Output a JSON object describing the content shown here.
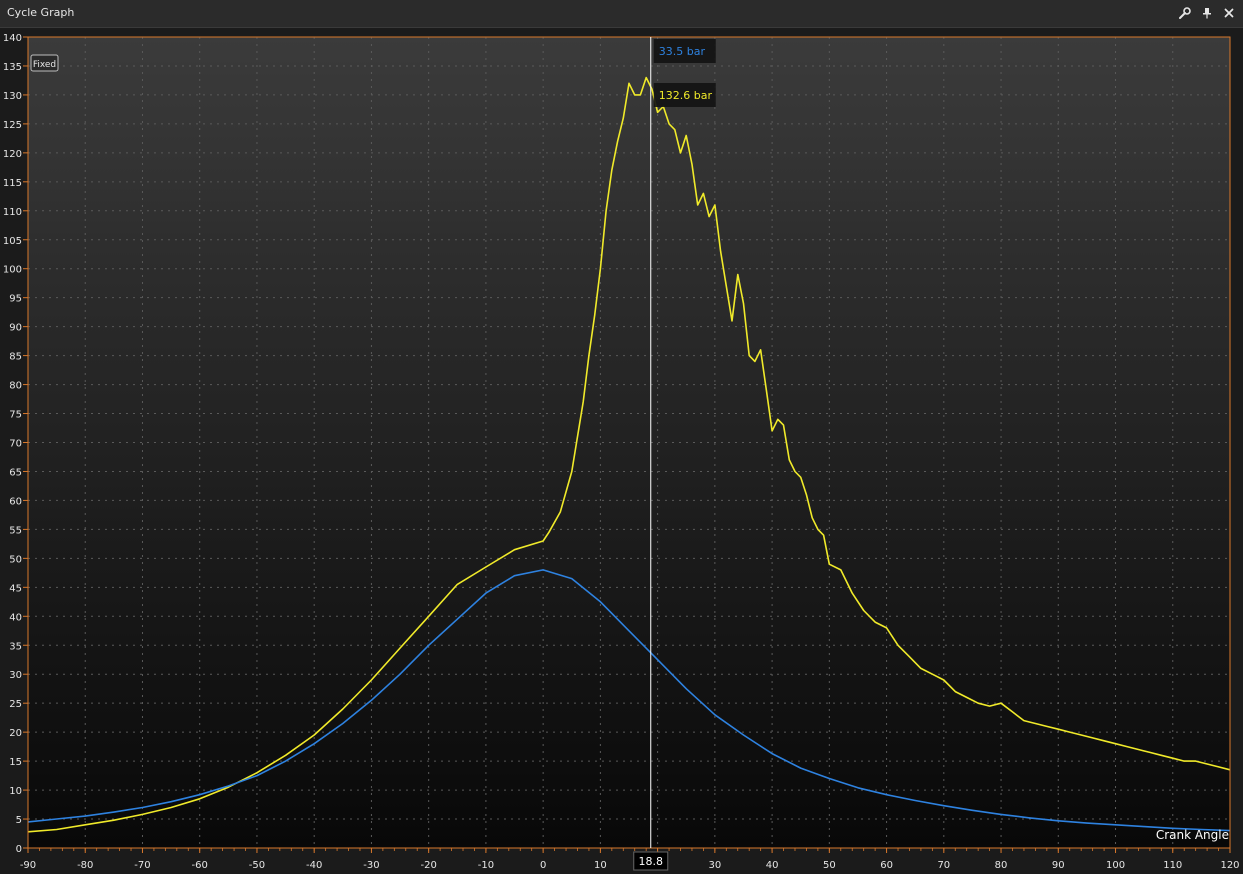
{
  "window": {
    "title": "Cycle Graph",
    "icons": [
      "wrench-icon",
      "pin-icon",
      "close-icon"
    ]
  },
  "colors": {
    "plot_bg_top": "#3b3b3b",
    "plot_bg_bottom": "#080808",
    "border": "#d9782b",
    "grid": "#5a5a5a",
    "series_yellow": "#f0ea2a",
    "series_blue": "#2e82e0",
    "cursor": "#ffffff"
  },
  "chart_data": {
    "type": "line",
    "title": "",
    "xlabel": "Crank Angle",
    "ylabel": "",
    "xlim": [
      -90,
      120
    ],
    "ylim": [
      0,
      140
    ],
    "x_ticks": [
      -90,
      -80,
      -70,
      -60,
      -50,
      -40,
      -30,
      -20,
      -10,
      0,
      10,
      20,
      30,
      40,
      50,
      60,
      70,
      80,
      90,
      100,
      110,
      120
    ],
    "y_ticks": [
      0,
      5,
      10,
      15,
      20,
      25,
      30,
      35,
      40,
      45,
      50,
      55,
      60,
      65,
      70,
      75,
      80,
      85,
      90,
      95,
      100,
      105,
      110,
      115,
      120,
      125,
      130,
      135,
      140
    ],
    "grid": true,
    "badge": "Fixed",
    "cursor": {
      "x": 18.8,
      "x_label": "18.8",
      "readouts": [
        {
          "label": "33.5 bar",
          "value": 33.5,
          "color": "#2e82e0"
        },
        {
          "label": "132.6 bar",
          "value": 132.6,
          "color": "#f0ea2a"
        }
      ]
    },
    "series": [
      {
        "color": "#f0ea2a",
        "x": [
          -90,
          -85,
          -80,
          -75,
          -70,
          -65,
          -60,
          -55,
          -50,
          -45,
          -40,
          -35,
          -30,
          -25,
          -20,
          -15,
          -10,
          -5,
          0,
          1,
          3,
          5,
          7,
          8,
          9,
          10,
          11,
          12,
          13,
          14,
          15,
          16,
          17,
          18,
          19,
          20,
          21,
          22,
          23,
          24,
          25,
          26,
          27,
          28,
          29,
          30,
          31,
          32,
          33,
          34,
          35,
          36,
          37,
          38,
          39,
          40,
          41,
          42,
          43,
          44,
          45,
          46,
          47,
          48,
          49,
          50,
          52,
          54,
          56,
          58,
          60,
          62,
          64,
          66,
          68,
          70,
          72,
          74,
          76,
          78,
          80,
          82,
          84,
          86,
          88,
          90,
          92,
          94,
          96,
          98,
          100,
          102,
          104,
          106,
          108,
          110,
          112,
          114,
          116,
          118,
          120
        ],
        "values": [
          2.8,
          3.2,
          4.0,
          4.8,
          5.8,
          7.0,
          8.5,
          10.5,
          13.0,
          16.0,
          19.5,
          24.0,
          29.0,
          34.5,
          40.0,
          45.5,
          48.5,
          51.5,
          53.0,
          54.5,
          58.0,
          65.0,
          77.0,
          85.0,
          92.0,
          100.0,
          110.0,
          117.0,
          122.0,
          126.0,
          132.0,
          130.0,
          130.0,
          133.0,
          131.0,
          127.0,
          128.0,
          125.0,
          124.0,
          120.0,
          123.0,
          118.0,
          111.0,
          113.0,
          109.0,
          111.0,
          103.0,
          97.0,
          91.0,
          99.0,
          94.0,
          85.0,
          84.0,
          86.0,
          79.0,
          72.0,
          74.0,
          73.0,
          67.0,
          65.0,
          64.0,
          61.0,
          57.0,
          55.0,
          54.0,
          49.0,
          48.0,
          44.0,
          41.0,
          39.0,
          38.0,
          35.0,
          33.0,
          31.0,
          30.0,
          29.0,
          27.0,
          26.0,
          25.0,
          24.5,
          25.0,
          23.5,
          22.0,
          21.5,
          21.0,
          20.5,
          20.0,
          19.5,
          19.0,
          18.5,
          18.0,
          17.5,
          17.0,
          16.5,
          16.0,
          15.5,
          15.0,
          15.0,
          14.5,
          14.0,
          13.5
        ]
      },
      {
        "color": "#2e82e0",
        "x": [
          -90,
          -85,
          -80,
          -75,
          -70,
          -65,
          -60,
          -55,
          -50,
          -45,
          -40,
          -35,
          -30,
          -25,
          -20,
          -15,
          -10,
          -5,
          0,
          5,
          10,
          15,
          20,
          25,
          30,
          35,
          40,
          45,
          50,
          55,
          60,
          65,
          70,
          75,
          80,
          85,
          90,
          95,
          100,
          105,
          110,
          115,
          120
        ],
        "values": [
          4.5,
          5.0,
          5.5,
          6.2,
          7.0,
          8.0,
          9.2,
          10.7,
          12.5,
          15.0,
          18.0,
          21.5,
          25.5,
          30.0,
          35.0,
          39.5,
          44.0,
          47.0,
          48.0,
          46.5,
          42.5,
          37.5,
          32.5,
          27.5,
          23.0,
          19.5,
          16.3,
          13.8,
          12.0,
          10.4,
          9.2,
          8.2,
          7.3,
          6.5,
          5.8,
          5.2,
          4.7,
          4.3,
          4.0,
          3.7,
          3.4,
          3.2,
          3.0
        ]
      }
    ]
  }
}
